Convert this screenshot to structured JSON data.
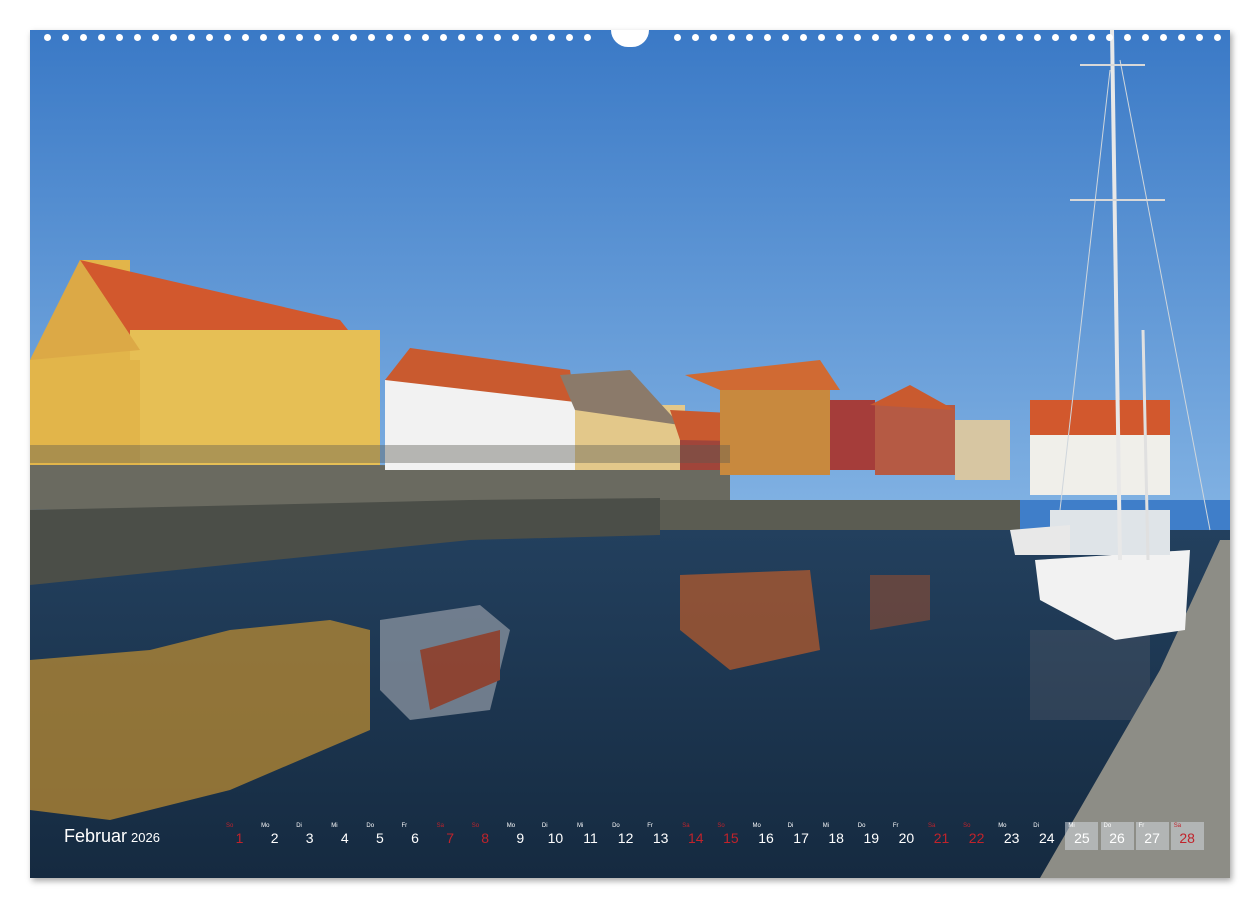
{
  "calendar": {
    "month": "Februar",
    "year": "2026",
    "days": [
      {
        "n": "1",
        "wd": "So",
        "we": true
      },
      {
        "n": "2",
        "wd": "Mo",
        "we": false
      },
      {
        "n": "3",
        "wd": "Di",
        "we": false
      },
      {
        "n": "4",
        "wd": "Mi",
        "we": false
      },
      {
        "n": "5",
        "wd": "Do",
        "we": false
      },
      {
        "n": "6",
        "wd": "Fr",
        "we": false
      },
      {
        "n": "7",
        "wd": "Sa",
        "we": true
      },
      {
        "n": "8",
        "wd": "So",
        "we": true
      },
      {
        "n": "9",
        "wd": "Mo",
        "we": false
      },
      {
        "n": "10",
        "wd": "Di",
        "we": false
      },
      {
        "n": "11",
        "wd": "Mi",
        "we": false
      },
      {
        "n": "12",
        "wd": "Do",
        "we": false
      },
      {
        "n": "13",
        "wd": "Fr",
        "we": false
      },
      {
        "n": "14",
        "wd": "Sa",
        "we": true
      },
      {
        "n": "15",
        "wd": "So",
        "we": true
      },
      {
        "n": "16",
        "wd": "Mo",
        "we": false
      },
      {
        "n": "17",
        "wd": "Di",
        "we": false
      },
      {
        "n": "18",
        "wd": "Mi",
        "we": false
      },
      {
        "n": "19",
        "wd": "Do",
        "we": false
      },
      {
        "n": "20",
        "wd": "Fr",
        "we": false
      },
      {
        "n": "21",
        "wd": "Sa",
        "we": true
      },
      {
        "n": "22",
        "wd": "So",
        "we": true
      },
      {
        "n": "23",
        "wd": "Mo",
        "we": false
      },
      {
        "n": "24",
        "wd": "Di",
        "we": false
      },
      {
        "n": "25",
        "wd": "Mi",
        "we": false
      },
      {
        "n": "26",
        "wd": "Do",
        "we": false
      },
      {
        "n": "27",
        "wd": "Fr",
        "we": false
      },
      {
        "n": "28",
        "wd": "Sa",
        "we": true
      }
    ],
    "highlighted": [
      "25",
      "26",
      "27",
      "28"
    ]
  },
  "colors": {
    "sky": "#3f7ec9",
    "water": "#1c3550",
    "weekend": "#c0232b",
    "roof": "#d2582d",
    "yellow_house": "#e2b54a"
  }
}
